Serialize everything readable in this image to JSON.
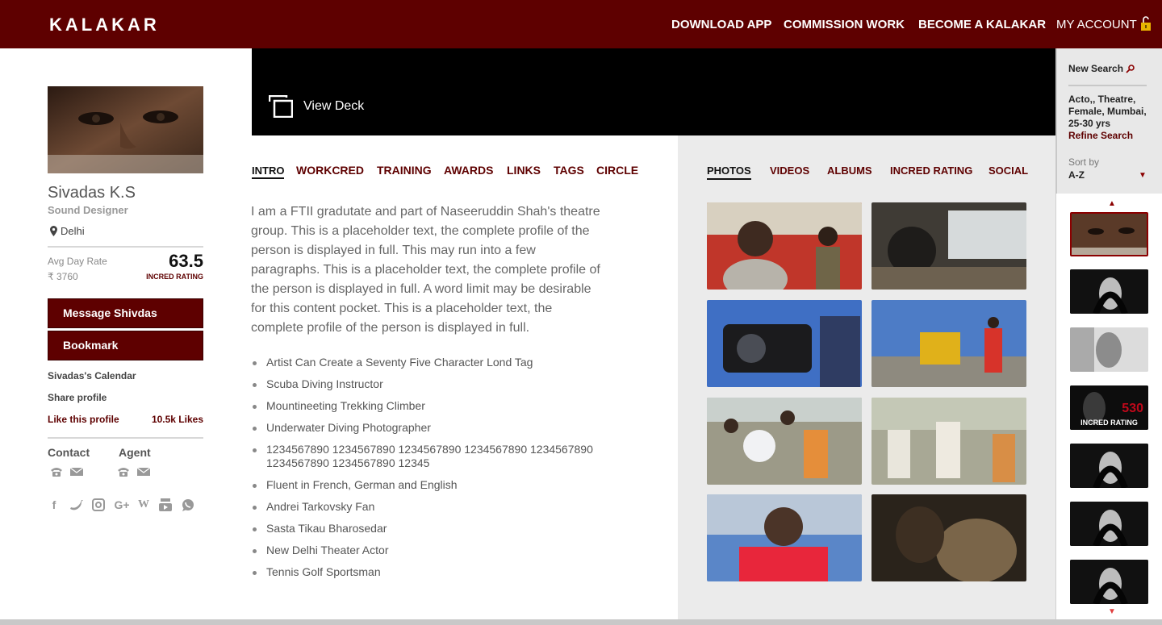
{
  "app": {
    "logo": "KALAKAR"
  },
  "nav": {
    "download": "DOWNLOAD APP",
    "commission": "COMMISSION WORK",
    "become": "BECOME A KALAKAR",
    "account": "MY ACCOUNT"
  },
  "profile": {
    "name": "Sivadas K.S",
    "role": "Sound Designer",
    "location": "Delhi",
    "avg_rate_label": "Avg Day Rate",
    "avg_rate_value": "₹ 3760",
    "rating": "63.5",
    "rating_label": "INCRED RATING",
    "message_button": "Message Shivdas",
    "bookmark_button": "Bookmark",
    "calendar_link": "Sivadas's Calendar",
    "share_link": "Share profile",
    "like_link": "Like this profile",
    "likes_count": "10.5k Likes",
    "contact_label": "Contact",
    "agent_label": "Agent",
    "social_icons": [
      "facebook-icon",
      "twitter-icon",
      "instagram-icon",
      "google-plus-icon",
      "wikipedia-icon",
      "youtube-icon",
      "whatsapp-icon"
    ]
  },
  "deck": {
    "label": "View Deck"
  },
  "tabs": [
    "INTRO",
    "WORKCRED",
    "TRAINING",
    "AWARDS",
    "LINKS",
    "TAGS",
    "CIRCLE"
  ],
  "intro": {
    "text": "I am a FTII gradutate and part of Naseeruddin Shah's theatre group. This is a placeholder text, the complete profile of the person is displayed in full. This may run into a few paragraphs. This is a placeholder text, the complete profile of the person is displayed in full. A word limit may be desirable for this content pocket. This is a placeholder text, the complete profile of the person is displayed in full.",
    "bullets": [
      "Artist Can Create a Seventy Five Character Lond Tag",
      "Scuba Diving Instructor",
      "Mountineeting Trekking Climber",
      "Underwater Diving Photographer",
      "1234567890 1234567890 1234567890 1234567890 1234567890 1234567890 1234567890 12345",
      "Fluent in French, German and English",
      "Andrei Tarkovsky Fan",
      "Sasta Tikau Bharosedar",
      "New Delhi Theater Actor",
      "Tennis Golf Sportsman"
    ]
  },
  "media_tabs": [
    "PHOTOS",
    "VIDEOS",
    "ALBUMS",
    "INCRED RATING",
    "SOCIAL"
  ],
  "sidebar": {
    "new_search": "New Search",
    "criteria": "Acto,, Theatre, Female, Mumbai, 25-30 yrs",
    "refine": "Refine Search",
    "sort_by_label": "Sort by",
    "sort_value": "A-Z",
    "thumb_rating": "530",
    "thumb_rating_label": "INCRED RATING"
  },
  "colors": {
    "brand": "#5e0000",
    "accent": "#8b0000",
    "panel": "#ebebeb"
  }
}
